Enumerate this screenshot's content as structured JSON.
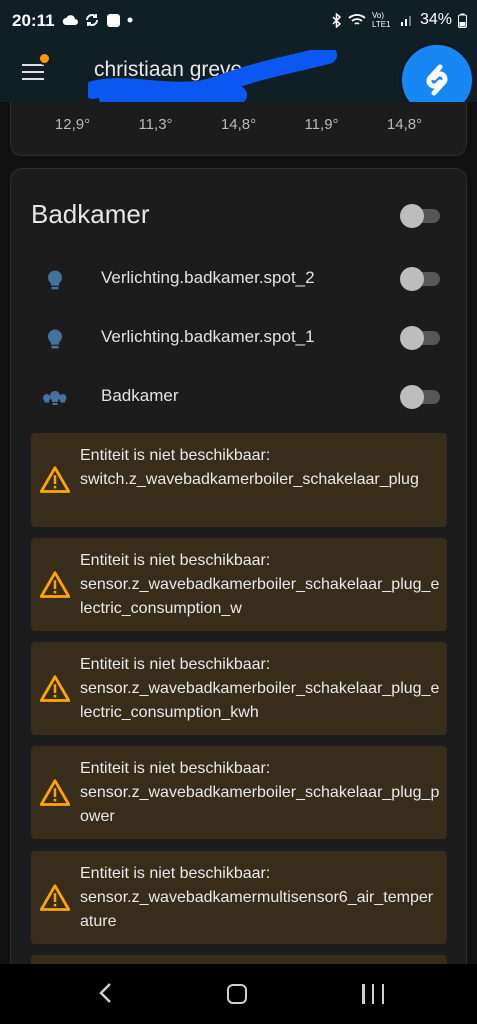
{
  "status_bar": {
    "time": "20:11",
    "battery": "34%",
    "network": "Vo) LTE1"
  },
  "header": {
    "title": "christiaan greve"
  },
  "weather": {
    "temps": [
      "12,9°",
      "11,3°",
      "14,8°",
      "11,9°",
      "14,8°"
    ]
  },
  "card": {
    "title": "Badkamer",
    "entities": [
      {
        "label": "Verlichting.badkamer.spot_2",
        "icon": "lightbulb-icon"
      },
      {
        "label": "Verlichting.badkamer.spot_1",
        "icon": "lightbulb-icon"
      },
      {
        "label": "Badkamer",
        "icon": "lightbulb-group-icon"
      }
    ],
    "warnings": [
      {
        "title": "Entiteit is niet beschikbaar:",
        "entity": "switch.z_wavebadkamerboiler_schakelaar_plug"
      },
      {
        "title": "Entiteit is niet beschikbaar:",
        "entity": "sensor.z_wavebadkamerboiler_schakelaar_plug_electric_consumption_w"
      },
      {
        "title": "Entiteit is niet beschikbaar:",
        "entity": "sensor.z_wavebadkamerboiler_schakelaar_plug_electric_consumption_kwh"
      },
      {
        "title": "Entiteit is niet beschikbaar:",
        "entity": "sensor.z_wavebadkamerboiler_schakelaar_plug_power"
      },
      {
        "title": "Entiteit is niet beschikbaar:",
        "entity": "sensor.z_wavebadkamermultisensor6_air_temperature"
      }
    ]
  },
  "colors": {
    "header_bg": "#101e26",
    "card_bg": "#1c1c1c",
    "warning_bg": "#372d1a",
    "warning_icon": "#ffa600",
    "bulb_icon": "#44739e",
    "notification_dot": "#ff9800",
    "shazam_blue": "#1787f4"
  }
}
